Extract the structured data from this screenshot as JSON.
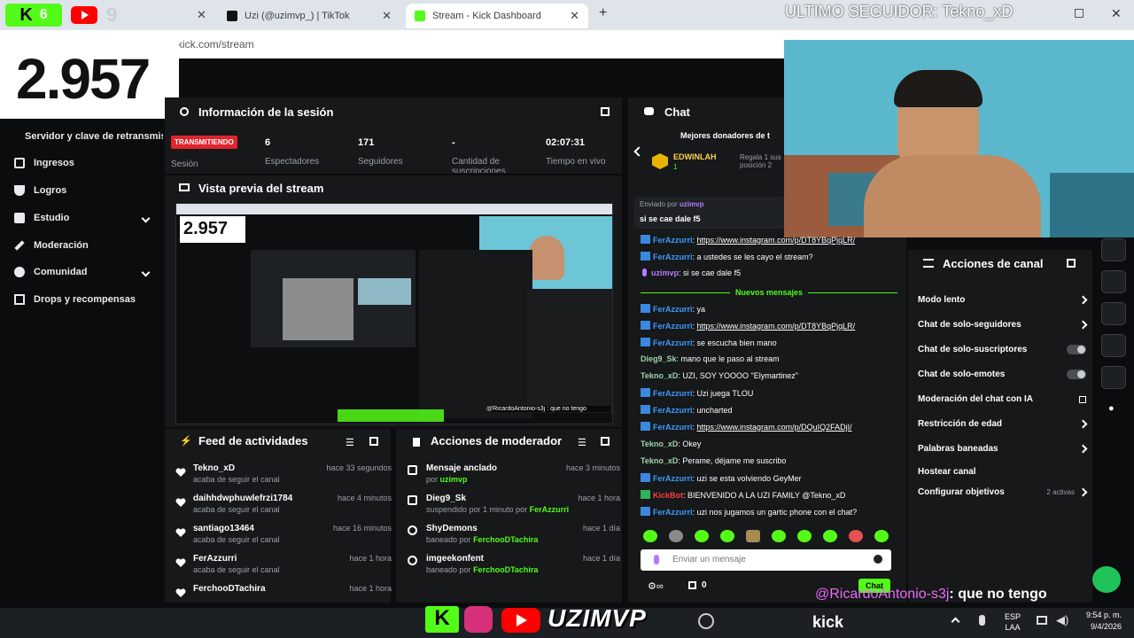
{
  "browser": {
    "tabs": [
      {
        "label": "Uzi (@uzimvp_) | TikTok"
      },
      {
        "label": "Stream - Kick Dashboard"
      }
    ],
    "url": "kick.com/stream",
    "overlay_badges": [
      "6",
      "9"
    ]
  },
  "overlay": {
    "follower_count": "2.957",
    "last_follower": "ULTIMO SEGUIDOR: Tekno_xD",
    "chat_caption_user": "@RicardoAntonio-s3j",
    "chat_caption_text": ": que no tengo",
    "bottom_logo": "UZIMVP",
    "kick_text": "kick"
  },
  "sidebar": {
    "items": [
      {
        "label": "Servidor y clave de retransmisión",
        "icon": "key-icon"
      },
      {
        "label": "Ingresos",
        "icon": "money-icon"
      },
      {
        "label": "Logros",
        "icon": "trophy-icon"
      },
      {
        "label": "Estudio",
        "icon": "studio-icon"
      },
      {
        "label": "Moderación",
        "icon": "wrench-icon"
      },
      {
        "label": "Comunidad",
        "icon": "users-icon"
      },
      {
        "label": "Drops y recompensas",
        "icon": "gift-icon"
      }
    ]
  },
  "session": {
    "title": "Información de la sesión",
    "status_badge": "TRANSMITIENDO",
    "status_label": "Sesión",
    "stats": [
      {
        "value": "6",
        "label": "Espectadores"
      },
      {
        "value": "171",
        "label": "Seguidores"
      },
      {
        "value": "-",
        "label": "Cantidad de suscripciones"
      },
      {
        "value": "02:07:31",
        "label": "Tiempo en vivo"
      }
    ]
  },
  "preview": {
    "title": "Vista previa del stream",
    "thumb_count": "2.957",
    "thumb_caption": "@RicardoAntonio-s3j : que no tengo"
  },
  "feed": {
    "title": "Feed de actividades",
    "items": [
      {
        "user": "Tekno_xD",
        "sub": "acaba de seguir el canal",
        "time": "hace 33 segundos"
      },
      {
        "user": "daihhdwphuwlefrzi1784",
        "sub": "acaba de seguir el canal",
        "time": "hace 4 minutos"
      },
      {
        "user": "santiago13464",
        "sub": "acaba de seguir el canal",
        "time": "hace 16 minutos"
      },
      {
        "user": "FerAzzurri",
        "sub": "acaba de seguir el canal",
        "time": "hace 1 hora"
      },
      {
        "user": "FerchooDTachira",
        "sub": "",
        "time": "hace 1 hora"
      }
    ]
  },
  "mod": {
    "title": "Acciones de moderador",
    "items": [
      {
        "title": "Mensaje anclado",
        "sub_pre": "por",
        "sub_user": "uzimvp",
        "time": "hace 3 minutos",
        "icon": "pin-icon"
      },
      {
        "title": "Dieg9_Sk",
        "sub_pre": "suspendido por 1 minuto por",
        "sub_user": "FerAzzurri",
        "time": "hace 1 hora",
        "icon": "hourglass-icon"
      },
      {
        "title": "ShyDemons",
        "sub_pre": "baneado por",
        "sub_user": "FerchooDTachira",
        "time": "hace 1 día",
        "icon": "ban-icon"
      },
      {
        "title": "imgeekonfent",
        "sub_pre": "baneado por",
        "sub_user": "FerchooDTachira",
        "time": "hace 1 día",
        "icon": "ban-icon"
      }
    ]
  },
  "chat": {
    "title": "Chat",
    "donors_title": "Mejores donadores de t",
    "donor_name": "EDWINLAH",
    "donor_rank": "1",
    "donor_note": "Regala 1 sus posición 2",
    "pinned_by": "Enviado por",
    "pinned_user": "uzimvp",
    "pinned_text": "si se cae dale f5",
    "new_messages": "Nuevos mensajes",
    "messages": [
      {
        "user": "FerAzzurri",
        "text": "https://www.instagram.com/p/DT8YBqPjqLR/",
        "link": true,
        "badge": true,
        "color": "#3b9cff"
      },
      {
        "user": "FerAzzurri",
        "text": "a ustedes se les cayo el stream?",
        "link": false,
        "badge": true,
        "color": "#3b9cff"
      },
      {
        "user": "uzimvp",
        "text": "si se cae dale f5",
        "link": false,
        "badge": false,
        "color": "#b57bff"
      },
      {
        "user": "FerAzzurri",
        "text": "ya",
        "link": false,
        "badge": true,
        "color": "#3b9cff"
      },
      {
        "user": "FerAzzurri",
        "text": "https://www.instagram.com/p/DT8YBqPjqLR/",
        "link": true,
        "badge": true,
        "color": "#3b9cff"
      },
      {
        "user": "FerAzzurri",
        "text": "se escucha bien mano",
        "link": false,
        "badge": true,
        "color": "#3b9cff"
      },
      {
        "user": "Dieg9_Sk",
        "text": "mano que le paso al stream",
        "link": false,
        "badge": false,
        "color": "#9fd4a8"
      },
      {
        "user": "Tekno_xD",
        "text": "UZI, SOY YOOOO \"Elymartinez\"",
        "link": false,
        "badge": false,
        "color": "#9fd4a8"
      },
      {
        "user": "FerAzzurri",
        "text": "Uzi juega TLOU",
        "link": false,
        "badge": true,
        "color": "#3b9cff"
      },
      {
        "user": "FerAzzurri",
        "text": "uncharted",
        "link": false,
        "badge": true,
        "color": "#3b9cff"
      },
      {
        "user": "FerAzzurri",
        "text": "https://www.instagram.com/p/DQuIQ2FADjI/",
        "link": true,
        "badge": true,
        "color": "#3b9cff"
      },
      {
        "user": "Tekno_xD",
        "text": "Okey",
        "link": false,
        "badge": false,
        "color": "#9fd4a8"
      },
      {
        "user": "Tekno_xD",
        "text": "Perame, déjame me suscribo",
        "link": false,
        "badge": false,
        "color": "#9fd4a8"
      },
      {
        "user": "FerAzzurri",
        "text": "uzi se esta volviendo GeyMer",
        "link": false,
        "badge": true,
        "color": "#3b9cff"
      },
      {
        "user": "KickBot",
        "text": "BIENVENIDO A LA UZI FAMILY @Tekno_xD",
        "link": false,
        "badge": true,
        "color": "#ff3b3b"
      },
      {
        "user": "FerAzzurri",
        "text": "uzi nos jugamos un gartic phone con el chat?",
        "link": false,
        "badge": true,
        "color": "#3b9cff"
      }
    ],
    "input_placeholder": "Enviar un mensaje",
    "points": "0",
    "send_label": "Chat"
  },
  "channel_actions": {
    "title": "Acciones de canal",
    "items": [
      {
        "label": "Modo lento",
        "control": "chevron"
      },
      {
        "label": "Chat de solo-seguidores",
        "control": "chevron"
      },
      {
        "label": "Chat de solo-suscriptores",
        "control": "toggle"
      },
      {
        "label": "Chat de solo-emotes",
        "control": "toggle"
      },
      {
        "label": "Moderación del chat con IA",
        "control": "external"
      },
      {
        "label": "Restricción de edad",
        "control": "chevron"
      },
      {
        "label": "Palabras baneadas",
        "control": "chevron"
      },
      {
        "label": "Hostear canal",
        "control": "none"
      },
      {
        "label": "Configurar objetivos",
        "control": "chevron",
        "extra": "2 activas"
      }
    ]
  },
  "taskbar": {
    "lang_top": "ESP",
    "lang_bottom": "LAA",
    "time": "9:54 p. m.",
    "date": "9/4/2026"
  },
  "colors": {
    "kick_green": "#53fc18",
    "live_red": "#e0242b",
    "panel": "#16181a",
    "link_blue": "#3b9cff"
  }
}
